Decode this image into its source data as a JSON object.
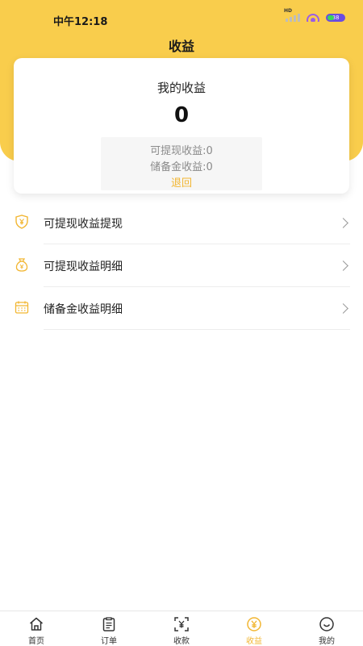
{
  "status_bar": {
    "time": "中午12:18",
    "network_badge": "HD",
    "battery_level": "88"
  },
  "header": {
    "title": "收益"
  },
  "earnings_card": {
    "title": "我的收益",
    "total": "0",
    "withdrawable_line": "可提现收益:0",
    "reserve_line": "储备金收益:0",
    "withdraw_link": "退回"
  },
  "menu": {
    "items": [
      {
        "label": "可提现收益提现",
        "icon": "shield-yen-icon"
      },
      {
        "label": "可提现收益明细",
        "icon": "money-bag-icon"
      },
      {
        "label": "储备金收益明细",
        "icon": "calendar-icon"
      }
    ]
  },
  "tabbar": {
    "items": [
      {
        "label": "首页",
        "icon": "home-icon"
      },
      {
        "label": "订单",
        "icon": "clipboard-icon"
      },
      {
        "label": "收款",
        "icon": "scan-yen-icon"
      },
      {
        "label": "收益",
        "icon": "yen-circle-icon",
        "active": true
      },
      {
        "label": "我的",
        "icon": "smile-icon"
      }
    ]
  },
  "colors": {
    "brand_yellow": "#F9CD4C",
    "accent_gold": "#F2B632",
    "divider": "#EDEDED"
  }
}
